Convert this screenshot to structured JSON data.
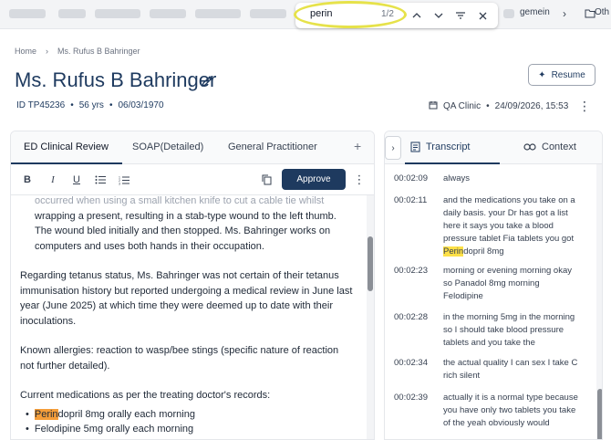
{
  "topbar": {
    "right_text": "gemein",
    "folder_label": "Oth"
  },
  "find": {
    "query": "perin",
    "count": "1/2"
  },
  "breadcrumb": [
    "Home",
    "Ms. Rufus B Bahringer"
  ],
  "patient": {
    "name": "Ms. Rufus B Bahringer",
    "id": "ID TP45236",
    "age": "56 yrs",
    "dob": "06/03/1970",
    "clinic": "QA Clinic",
    "datetime": "24/09/2026, 15:53"
  },
  "actions": {
    "resume": "Resume",
    "approve": "Approve"
  },
  "left_tabs": [
    "ED Clinical Review",
    "SOAP(Detailed)",
    "General Practitioner"
  ],
  "document": {
    "para1_faded": "occurred when using a small kitchen knife to cut a cable tie whilst",
    "para1": "wrapping a present, resulting in a stab-type wound to the left thumb. The wound bled initially and then stopped. Ms. Bahringer works on computers and uses both hands in their occupation.",
    "para2": "Regarding tetanus status, Ms. Bahringer was not certain of their tetanus immunisation history but reported undergoing a medical review in June last year (June 2025) at which time they were deemed up to date with their inoculations.",
    "para3": "Known allergies: reaction to wasp/bee stings (specific nature of reaction not further detailed).",
    "para4": "Current medications as per the treating doctor's records:",
    "med1_hl": "Perin",
    "med1_rest": "dopril 8mg orally each morning",
    "med2": "Felodipine 5mg orally each morning"
  },
  "right_tabs": [
    "Transcript",
    "Context"
  ],
  "transcript": [
    {
      "time": "00:02:09",
      "text": "always"
    },
    {
      "time": "00:02:11",
      "text_pre": "and the medications you take on a daily basis. your Dr has got a list here it says you take a blood pressure tablet Fia tablets you got ",
      "hl": "Perin",
      "text_post": "dopril 8mg"
    },
    {
      "time": "00:02:23",
      "text": "morning or evening morning okay so Panadol 8mg morning Felodipine"
    },
    {
      "time": "00:02:28",
      "text": "in the morning 5mg in the morning so I should take blood pressure tablets and you take the"
    },
    {
      "time": "00:02:34",
      "text": "the actual quality I can sex I take C rich silent"
    },
    {
      "time": "00:02:39",
      "text": "actually it is a normal type because you have only two tablets you take of the yeah obviously would"
    }
  ]
}
